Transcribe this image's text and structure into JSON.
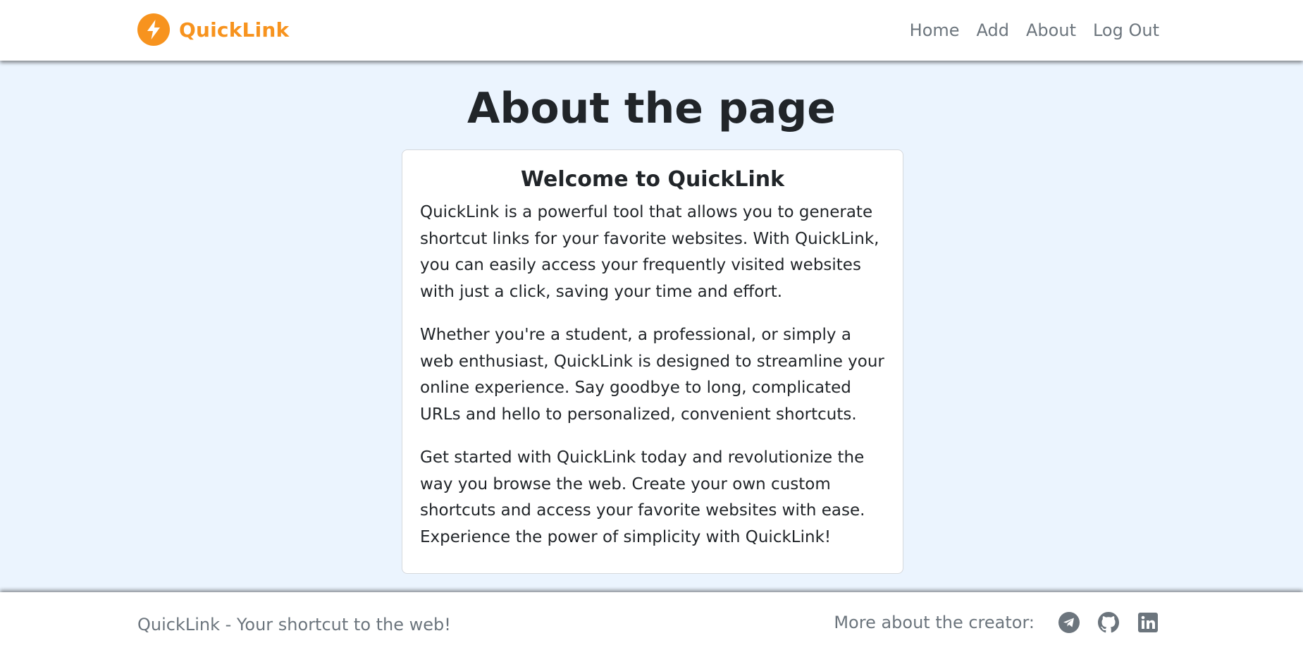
{
  "navbar": {
    "brand_name": "QuickLink",
    "brand_color": "#f7931e",
    "brand_icon": "lightning-bolt-icon",
    "links": [
      "Home",
      "Add",
      "About",
      "Log Out"
    ]
  },
  "main": {
    "title": "About the page",
    "card": {
      "title": "Welcome to QuickLink",
      "paragraphs": [
        "QuickLink is a powerful tool that allows you to generate shortcut links for your favorite websites. With QuickLink, you can easily access your frequently visited websites with just a click, saving your time and effort.",
        "Whether you're a student, a professional, or simply a web enthusiast, QuickLink is designed to streamline your online experience. Say goodbye to long, complicated URLs and hello to personalized, convenient shortcuts.",
        "Get started with QuickLink today and revolutionize the way you browse the web. Create your own custom shortcuts and access your favorite websites with ease. Experience the power of simplicity with QuickLink!"
      ]
    }
  },
  "footer": {
    "tagline": "QuickLink - Your shortcut to the web!",
    "creator_label": "More about the creator:",
    "social_icons": [
      "telegram-icon",
      "github-icon",
      "linkedin-icon"
    ]
  },
  "colors": {
    "page_background": "#ebf4fe",
    "accent": "#f7931e",
    "muted_text": "#6c757d",
    "icon_gray": "#6c757d"
  }
}
